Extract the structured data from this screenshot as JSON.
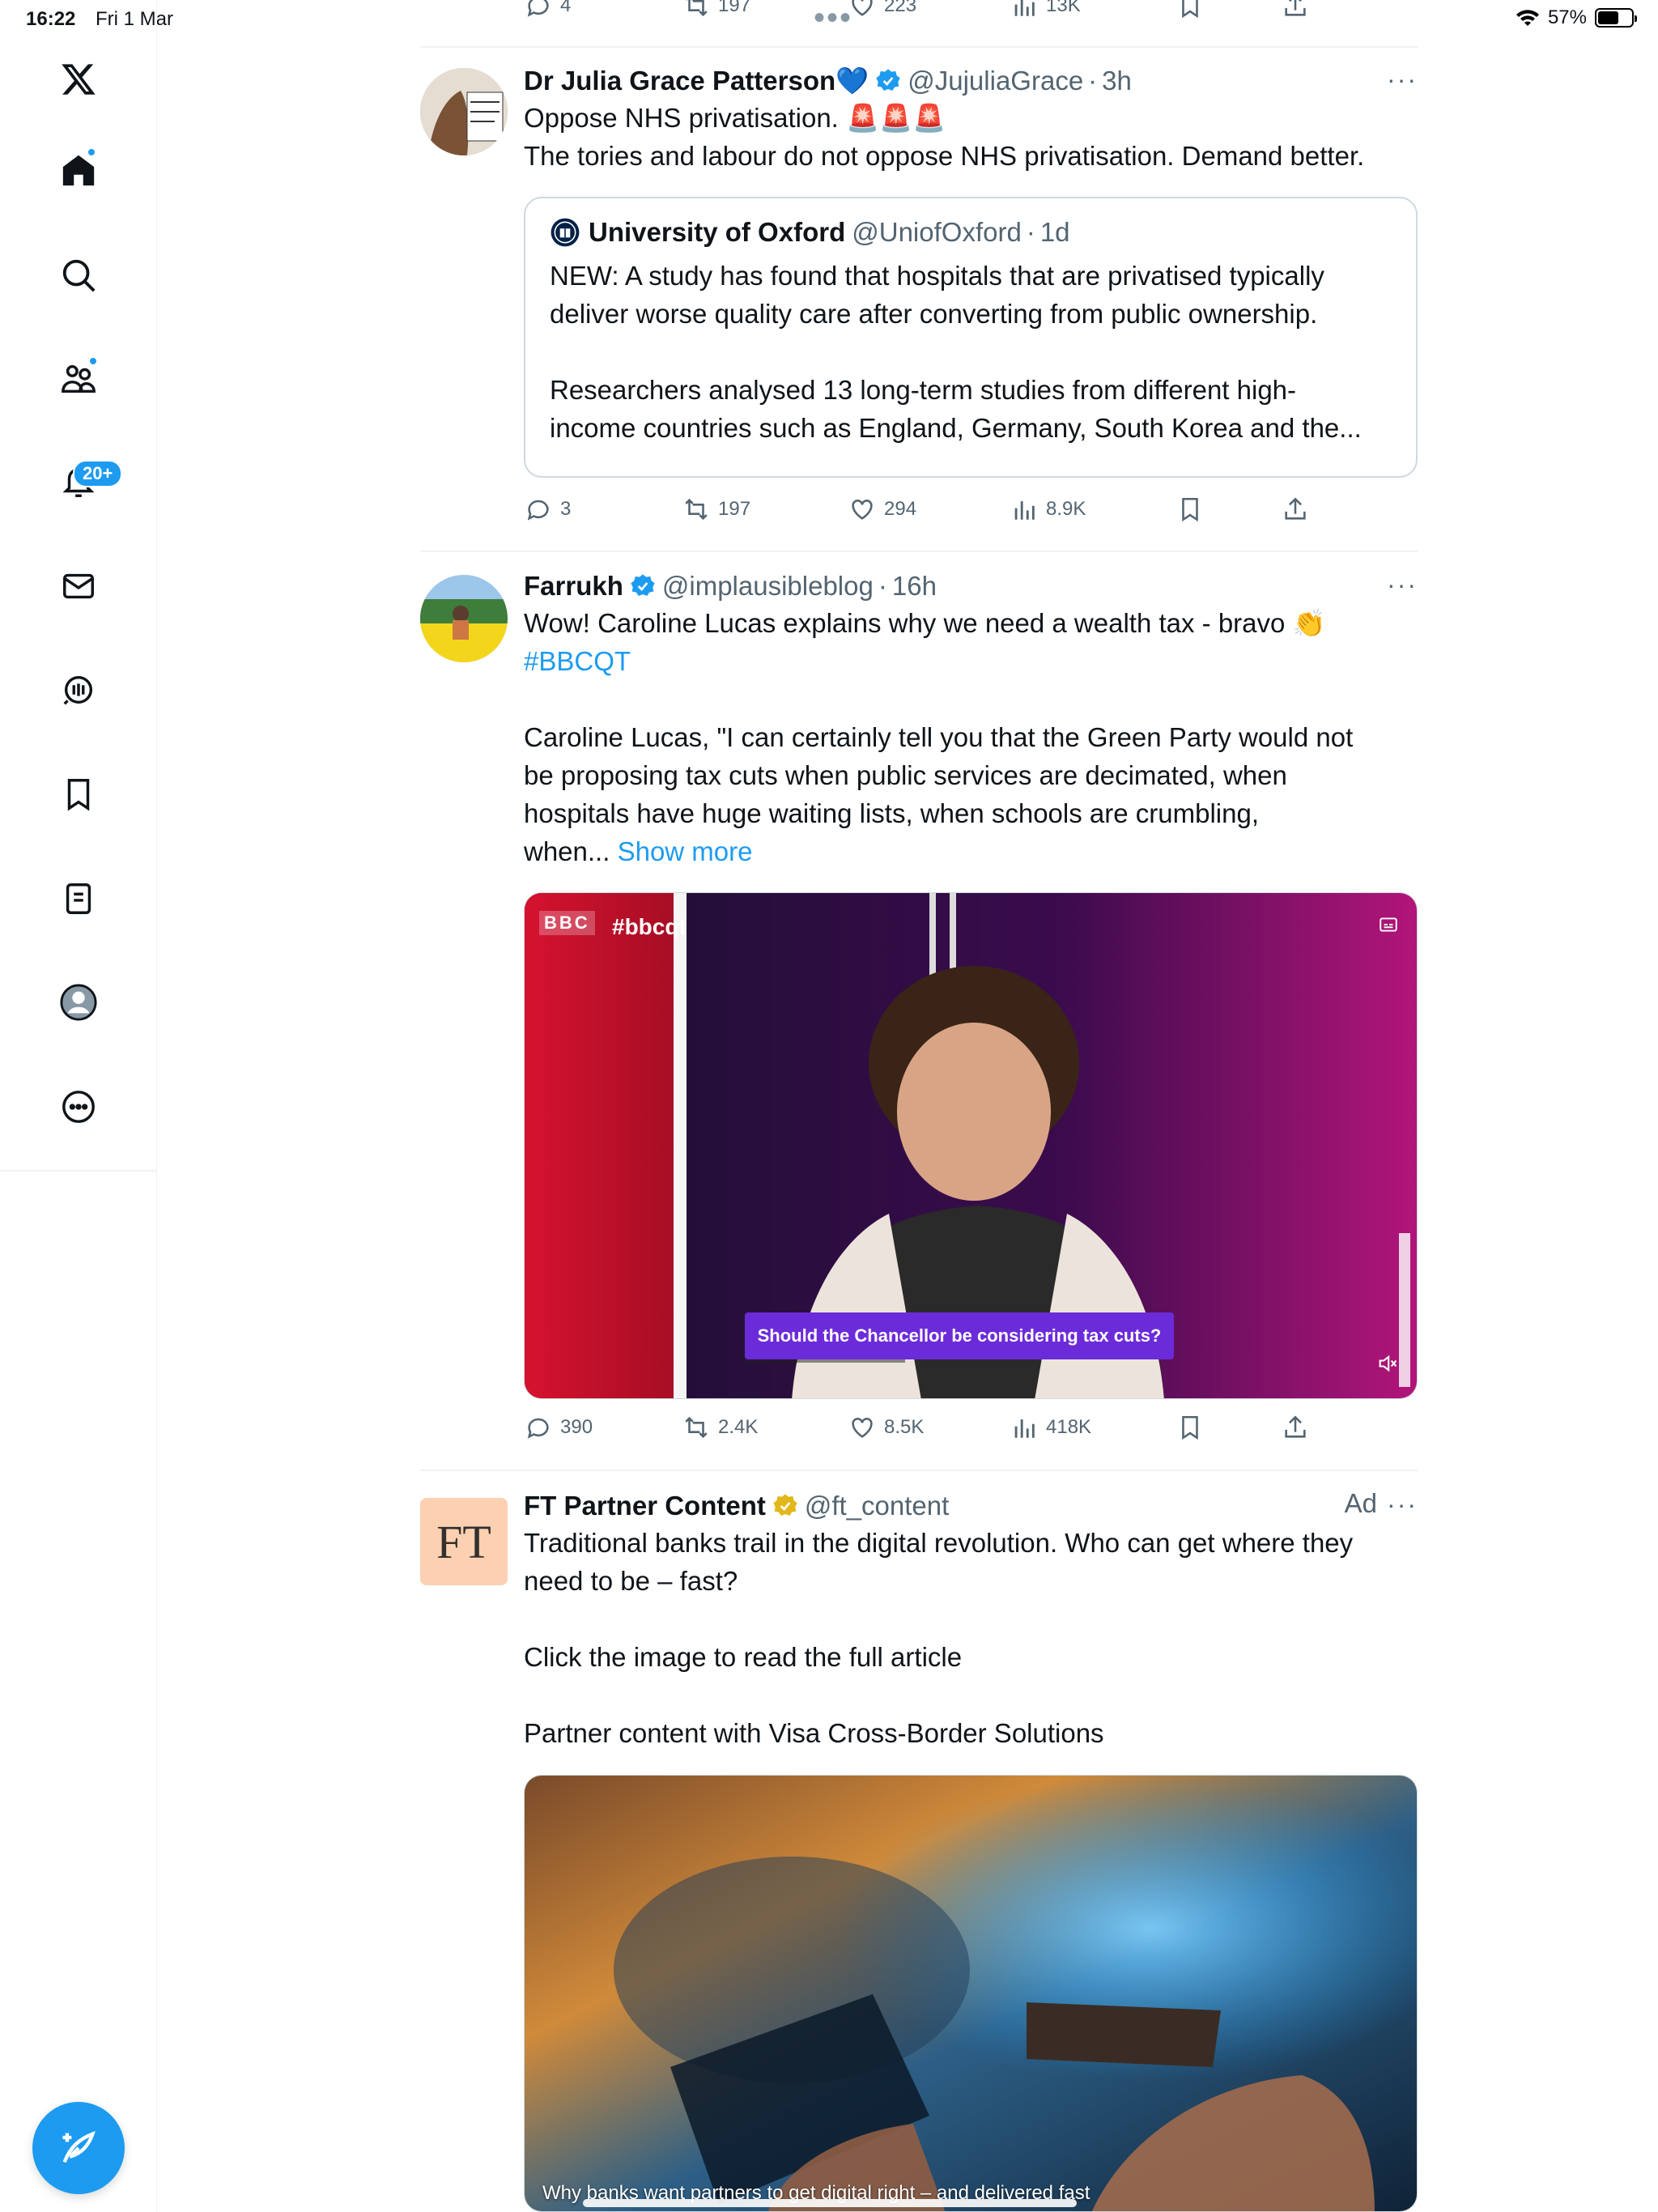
{
  "status_bar": {
    "time": "16:22",
    "date": "Fri 1 Mar",
    "battery": "57%"
  },
  "sidebar": {
    "notification_badge": "20+",
    "items": [
      "X",
      "Home",
      "Search",
      "Communities",
      "Notifications",
      "Messages",
      "Grok",
      "Bookmarks",
      "Lists",
      "Profile",
      "More"
    ]
  },
  "top_partial": {
    "replies": "4",
    "reposts": "197",
    "likes": "223",
    "views": "13K"
  },
  "tweets": [
    {
      "name": "Dr Julia Grace Patterson💙",
      "handle": "@JujuliaGrace",
      "sep": "·",
      "time": "3h",
      "text_line1": "Oppose NHS privatisation. 🚨🚨🚨",
      "text_line2": "The tories and labour do not oppose NHS privatisation. Demand better.",
      "quote": {
        "name": "University of Oxford",
        "handle": "@UniofOxford",
        "sep": "·",
        "time": "1d",
        "text": "NEW: A study has found that hospitals that are privatised typically\ndeliver worse quality care after converting from public ownership.\n\nResearchers analysed 13 long-term studies from different high-\nincome countries such as England, Germany, South Korea and the..."
      },
      "replies": "3",
      "reposts": "197",
      "likes": "294",
      "views": "8.9K"
    },
    {
      "name": "Farrukh",
      "handle": "@implausibleblog",
      "sep": "·",
      "time": "16h",
      "text_line1": "Wow! Caroline Lucas explains why we need a wealth tax - bravo 👏",
      "hashtag": "#BBCQT",
      "text_body": "Caroline Lucas, \"I can certainly tell you that the Green Party would not\nbe proposing tax cuts when public services are decimated, when\nhospitals have huge waiting lists, when schools are crumbling,\nwhen... ",
      "show_more": "Show more",
      "video": {
        "channel": "BBC",
        "hashtag": "#bbcqt",
        "caption": "Should the Chancellor be considering tax cuts?"
      },
      "replies": "390",
      "reposts": "2.4K",
      "likes": "8.5K",
      "views": "418K"
    },
    {
      "name": "FT Partner Content",
      "handle": "@ft_content",
      "ad_label": "Ad",
      "avatar_text": "FT",
      "text": "Traditional banks trail in the digital revolution. Who can get where they\nneed to be – fast?\n\nClick the image to read the full article\n\nPartner content with Visa Cross-Border Solutions",
      "image_caption": "Why banks want partners to get digital right – and delivered fast"
    }
  ],
  "colors": {
    "accent": "#1d9bf0",
    "text": "#0f1419",
    "muted": "#536471",
    "border": "#eff3f4"
  }
}
